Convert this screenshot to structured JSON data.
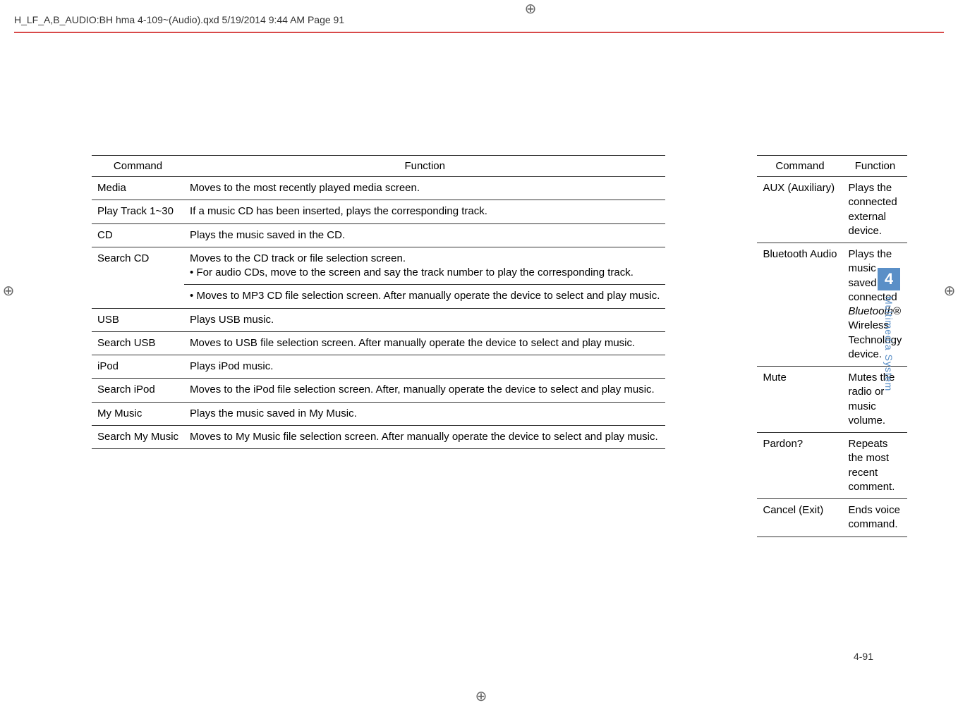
{
  "header_path": "H_LF_A,B_AUDIO:BH hma 4-109~(Audio).qxd  5/19/2014  9:44 AM  Page 91",
  "left_table": {
    "headers": [
      "Command",
      "Function"
    ],
    "rows": [
      {
        "cmd": "Media",
        "func": "Moves to the most recently played media screen."
      },
      {
        "cmd": "Play Track 1~30",
        "func": "If a music CD has been inserted, plays the corresponding track."
      },
      {
        "cmd": "CD",
        "func": "Plays the music saved in the CD."
      },
      {
        "cmd": "Search CD",
        "func_a": "Moves to the CD track or file selection screen.",
        "bullet_a": "• For audio CDs, move to the screen and say the track number to play the corresponding track.",
        "bullet_b": "• Moves to MP3 CD file selection screen. After manually operate the device to select and play music."
      },
      {
        "cmd": "USB",
        "func": "Plays USB music."
      },
      {
        "cmd": "Search USB",
        "func": "Moves to USB file selection screen. After manually operate the device to select and play music."
      },
      {
        "cmd": "iPod",
        "func": "Plays iPod music."
      },
      {
        "cmd": "Search iPod",
        "func": "Moves to the iPod file selection screen. After, manually operate the device to select and play music."
      },
      {
        "cmd": "My Music",
        "func": "Plays the music saved in My Music."
      },
      {
        "cmd": "Search My Music",
        "func": "Moves to My Music file selection screen. After manually operate the device to select and play music."
      }
    ]
  },
  "right_table": {
    "headers": [
      "Command",
      "Function"
    ],
    "rows": [
      {
        "cmd": "AUX (Auxiliary)",
        "func": "Plays the connected external device."
      },
      {
        "cmd": "Bluetooth Audio",
        "func_pre": "Plays the music saved in connected ",
        "func_italic": "Bluetooth®",
        "func_post": " Wireless Technology device."
      },
      {
        "cmd": "Mute",
        "func": "Mutes the radio or music volume."
      },
      {
        "cmd": "Pardon?",
        "func": "Repeats the most recent comment."
      },
      {
        "cmd": "Cancel (Exit)",
        "func": "Ends voice command."
      }
    ]
  },
  "side_tab": {
    "num": "4",
    "label": "Multimedia System"
  },
  "page_number": "4-91"
}
